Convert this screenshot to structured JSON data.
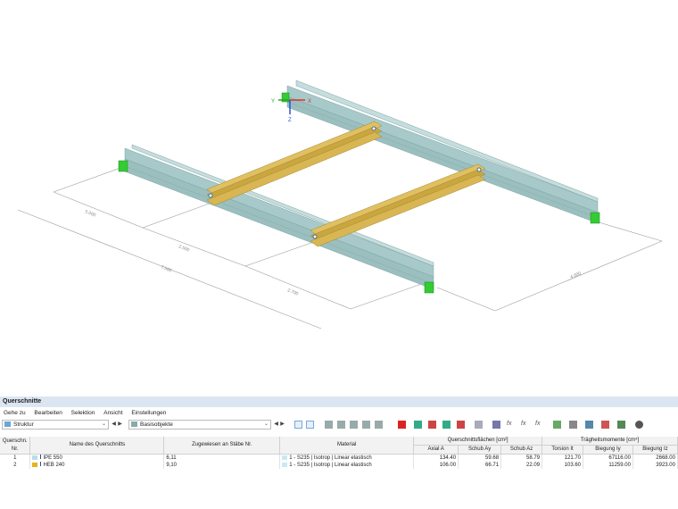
{
  "viewport": {
    "axes": {
      "x": "X",
      "y": "Y",
      "z": "Z"
    },
    "dimensions": [
      "5.000",
      "2.500",
      "7.500",
      "2.700",
      "4.000"
    ]
  },
  "panel": {
    "title": "Querschnitte",
    "menu": [
      "Gehe zu",
      "Bearbeiten",
      "Selektion",
      "Ansicht",
      "Einstellungen"
    ],
    "toolbar": {
      "combo1": "Struktur",
      "combo2": "Basisobjekte"
    },
    "table": {
      "group_headers": {
        "areas": "Querschnittsflächen [cm²]",
        "moments": "Trägheitsmomente [cm⁴]"
      },
      "headers": {
        "no": "Querschn. Nr.",
        "no_line1": "Querschn.",
        "no_line2": "Nr.",
        "name": "Name des Querschnitts",
        "assigned": "Zugewiesen an Stäbe Nr.",
        "material": "Material",
        "axial": "Axial A",
        "shear_y": "Schub Ay",
        "shear_z": "Schub Az",
        "torsion": "Torsion It",
        "bend_y": "Biegung Iy",
        "bend_z": "Biegung Iz"
      },
      "rows": [
        {
          "no": "1",
          "color": "#b9dde6",
          "name": "IPE 550",
          "assigned": "6,11",
          "mat_color": "#c8eaf2",
          "material": "1 - S235 | Isotrop | Linear elastisch",
          "axial": "134.40",
          "shear_y": "59.68",
          "shear_z": "58.79",
          "torsion": "121.70",
          "bend_y": "67116.00",
          "bend_z": "2668.00"
        },
        {
          "no": "2",
          "color": "#e8b21a",
          "name": "HEB 240",
          "assigned": "9,10",
          "mat_color": "#c8eaf2",
          "material": "1 - S235 | Isotrop | Linear elastisch",
          "axial": "106.00",
          "shear_y": "66.71",
          "shear_z": "22.09",
          "torsion": "103.60",
          "bend_y": "11259.00",
          "bend_z": "3923.00"
        }
      ]
    }
  }
}
